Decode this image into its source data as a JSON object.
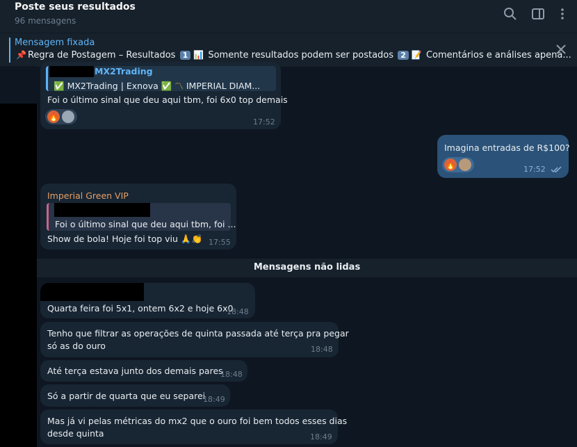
{
  "header": {
    "title": "Poste seus resultados",
    "subtitle": "96 mensagens"
  },
  "pinned": {
    "label": "Mensagem fixada",
    "part1": "Regra de Postagem – Resultados",
    "num1": "1",
    "part2": "Somente resultados podem ser postados",
    "num2": "2",
    "part3": "Comentários e análises apena..."
  },
  "messages": {
    "m1": {
      "quote_name": "MX2Trading",
      "quote_text": "MX2Trading | Exnova",
      "quote_text2": "IMPERIAL DIAM...",
      "text": "Foi o último sinal que deu aqui tbm, foi 6x0 top demais",
      "time": "17:52"
    },
    "m2": {
      "text": "Imagina entradas de R$100?",
      "time": "17:52"
    },
    "m3": {
      "sender": "Imperial Green VIP",
      "quote_text": "Foi o último sinal que deu aqui tbm, foi ...",
      "text": "Show de bola! Hoje foi top viu",
      "time": "17:55"
    },
    "unread_label": "Mensagens não lidas",
    "m4": {
      "text": "Quarta feira foi 5x1, ontem 6x2 e hoje 6x0",
      "time": "18:48"
    },
    "m5": {
      "line1": "Tenho que filtrar as operações de quinta passada até terça pra pegar",
      "line2": "só as do ouro",
      "time": "18:48"
    },
    "m6": {
      "text": "Até terça estava junto dos demais pares",
      "time": "18:48"
    },
    "m7": {
      "text": "Só a partir de quarta que eu separei",
      "time": "18:49"
    },
    "m8": {
      "line1": "Mas já vi pelas métricas do mx2 que o ouro foi bem todos esses dias",
      "line2": "desde quinta",
      "time": "18:49"
    }
  },
  "colors": {
    "accent": "#5eb5f7",
    "sender_name": "#e8a064",
    "outgoing": "#2b5278",
    "incoming": "#182533"
  }
}
